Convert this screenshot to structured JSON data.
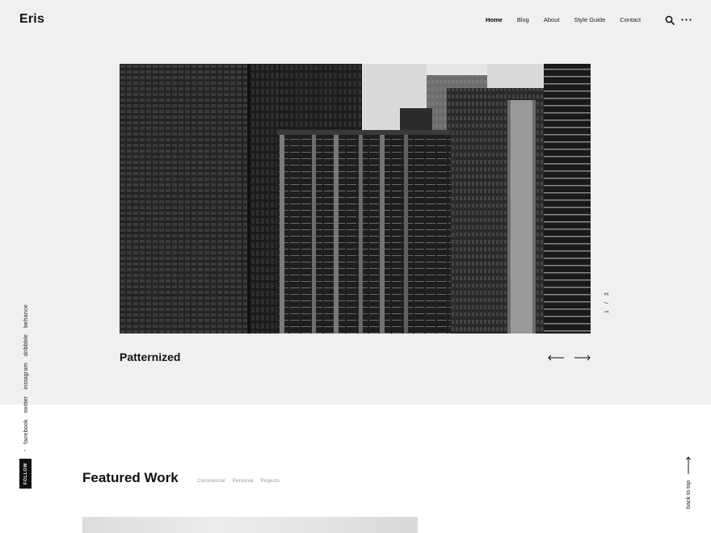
{
  "header": {
    "logo": "Eris",
    "nav": [
      {
        "label": "Home",
        "active": true
      },
      {
        "label": "Blog",
        "active": false
      },
      {
        "label": "About",
        "active": false
      },
      {
        "label": "Style Guide",
        "active": false
      },
      {
        "label": "Contact",
        "active": false
      }
    ],
    "icons": [
      "search-icon",
      "more-dots-icon"
    ]
  },
  "slider": {
    "title": "Patternized",
    "current": "1",
    "separator": "/",
    "total": "3",
    "image": "grayscale skyscraper facades"
  },
  "social": {
    "follow_label": "FOLLOW",
    "dash": "-",
    "links": [
      "facebook",
      "twitter",
      "instagram",
      "dribbble",
      "behance"
    ]
  },
  "featured": {
    "title": "Featured Work",
    "filters": [
      "Commercial",
      "Personal",
      "Projects"
    ]
  },
  "back_to_top": "back to top",
  "colors": {
    "hero_background": "#f0f0f2",
    "text": "#111111",
    "muted": "#999999",
    "page_background": "#ffffff"
  }
}
